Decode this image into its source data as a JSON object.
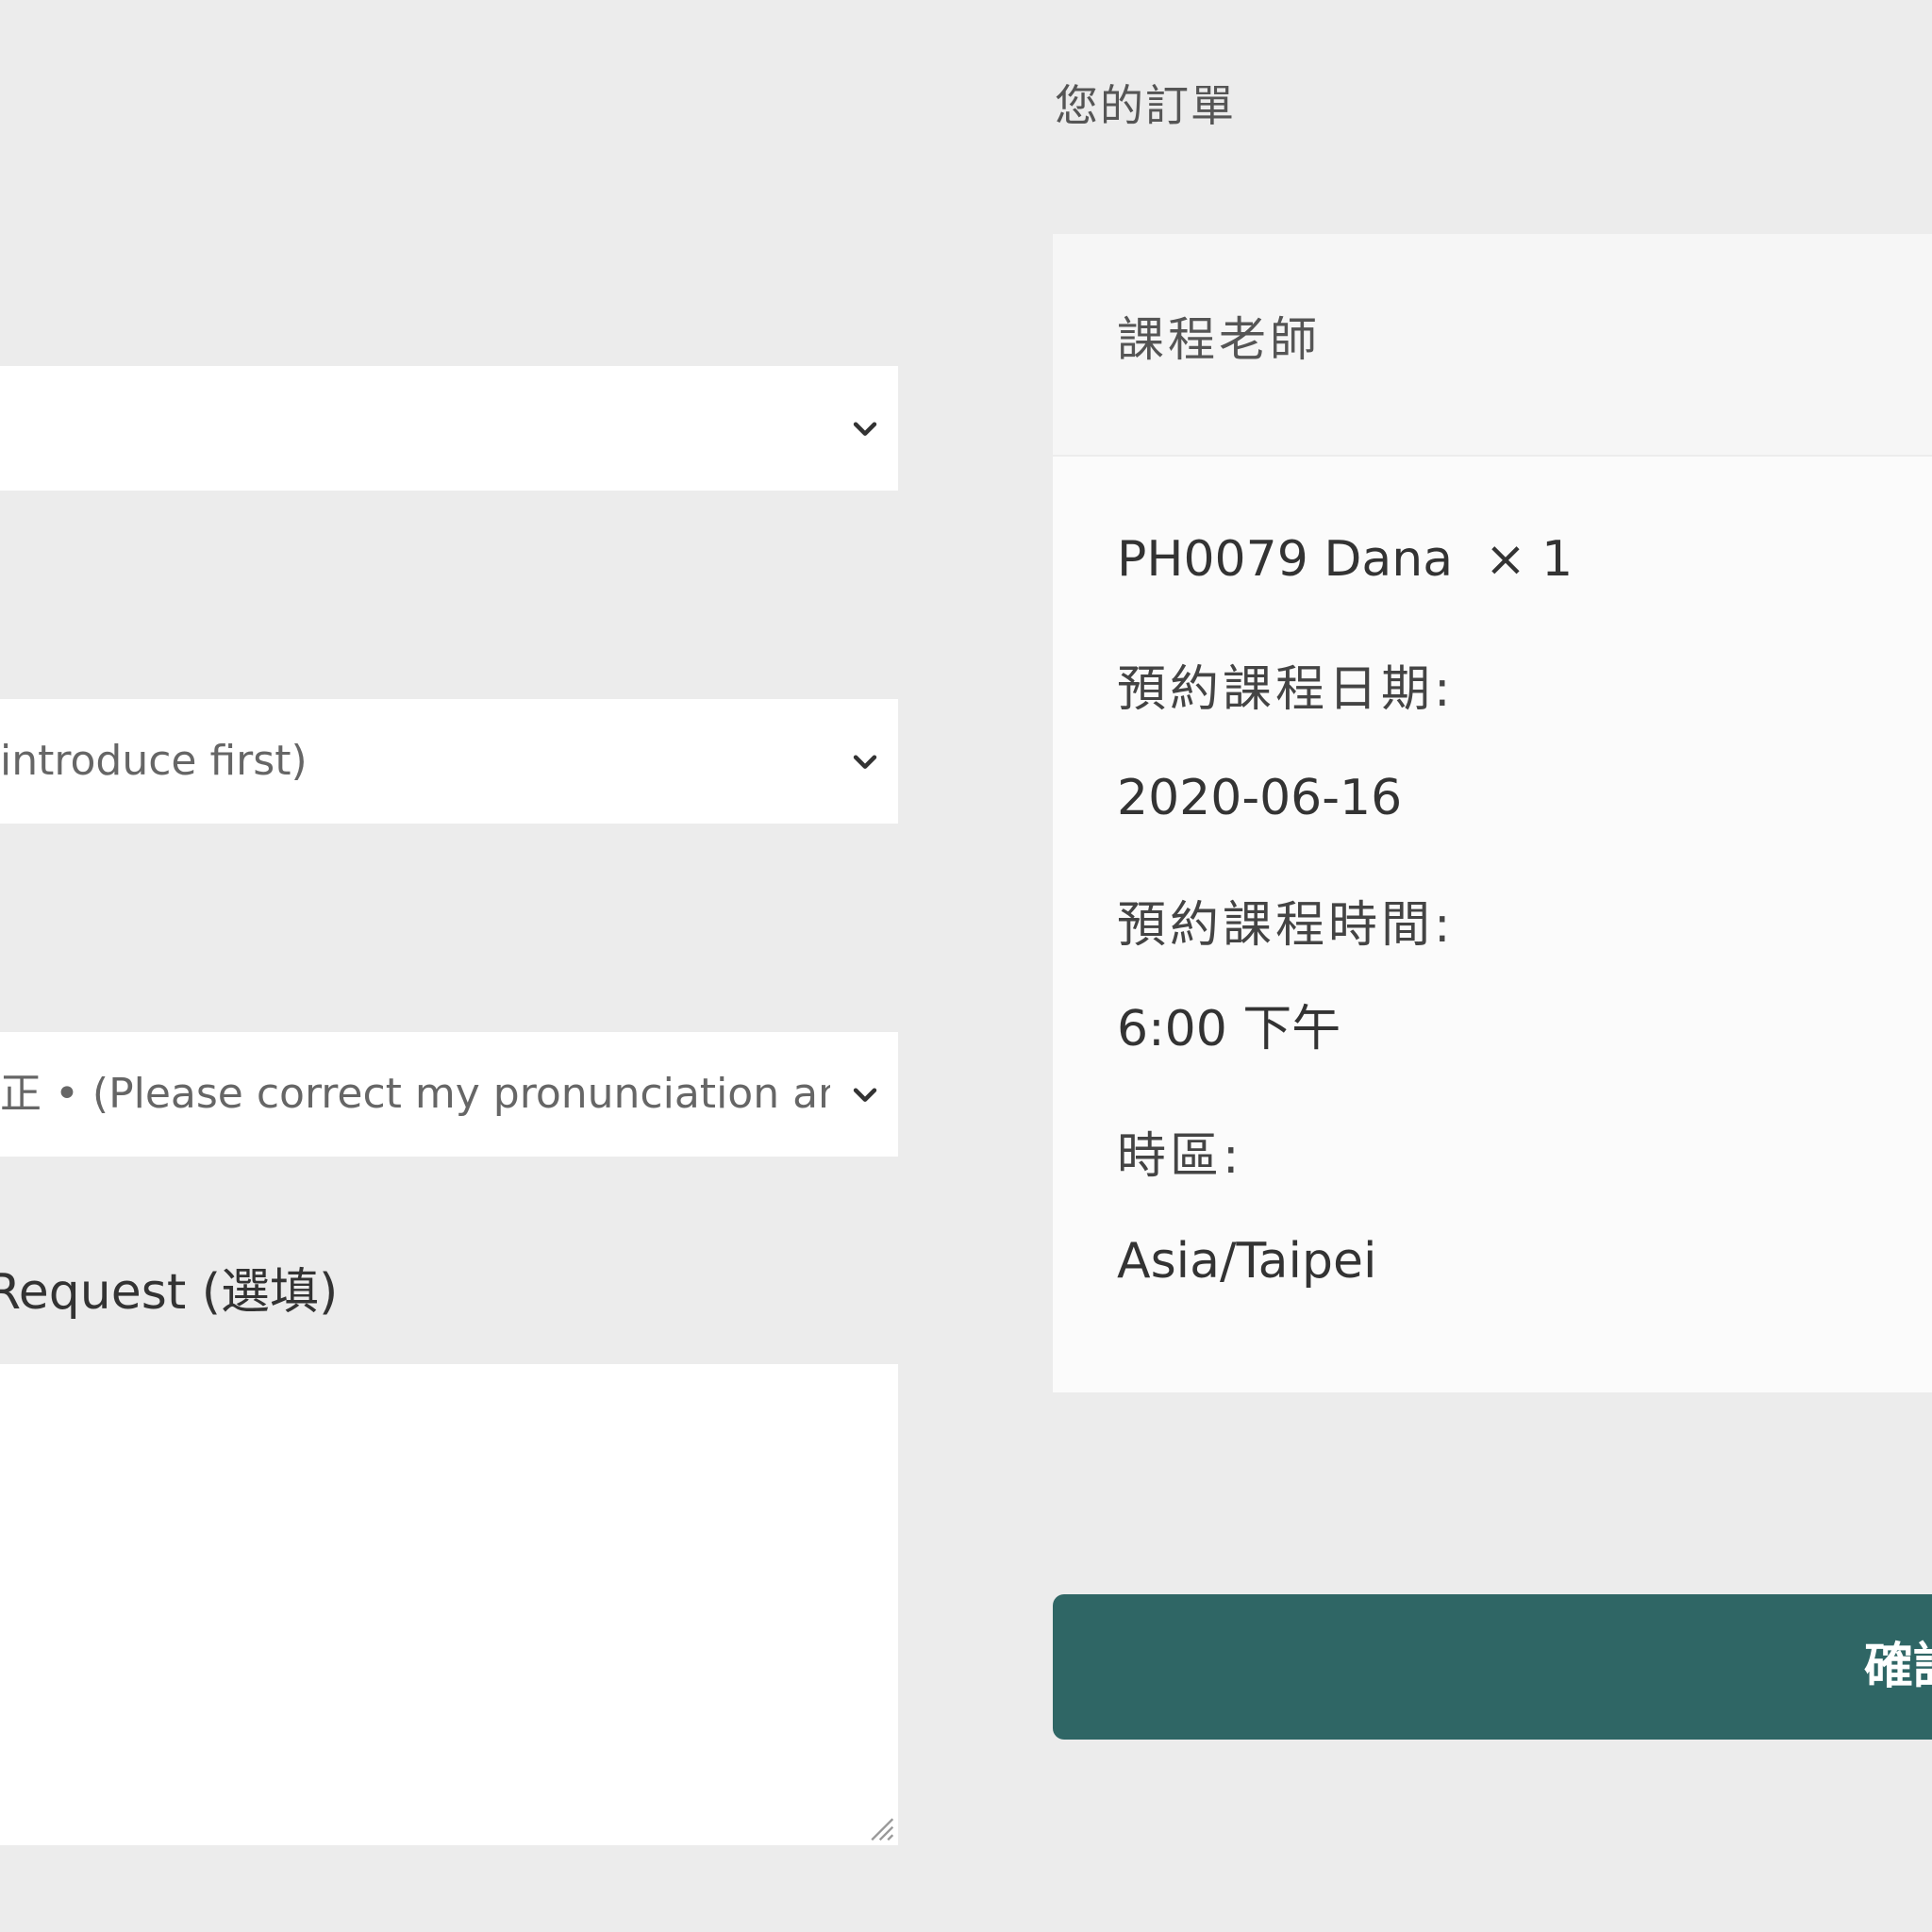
{
  "form": {
    "select_1": {
      "value": ""
    },
    "select_2": {
      "value": "introduce first)"
    },
    "select_3": {
      "value": "正 • (Please correct my pronunciation an"
    },
    "special_request": {
      "label": "Request (選填)",
      "value": ""
    }
  },
  "order": {
    "title": "您的訂單",
    "header_label": "課程老師",
    "teacher": "PH0079 Dana",
    "quantity": "× 1",
    "date_label": "預約課程日期:",
    "date_value": "2020-06-16",
    "time_label": "預約課程時間:",
    "time_value": "6:00 下午",
    "timezone_label": "時區:",
    "timezone_value": "Asia/Taipei",
    "confirm_label": "確認"
  },
  "colors": {
    "page_background": "#ececec",
    "card_background": "#fbfbfb",
    "accent": "#2f6665"
  },
  "icons": {
    "select_arrow": "chevron-down-icon",
    "textarea_resize": "resize-grip-icon"
  }
}
